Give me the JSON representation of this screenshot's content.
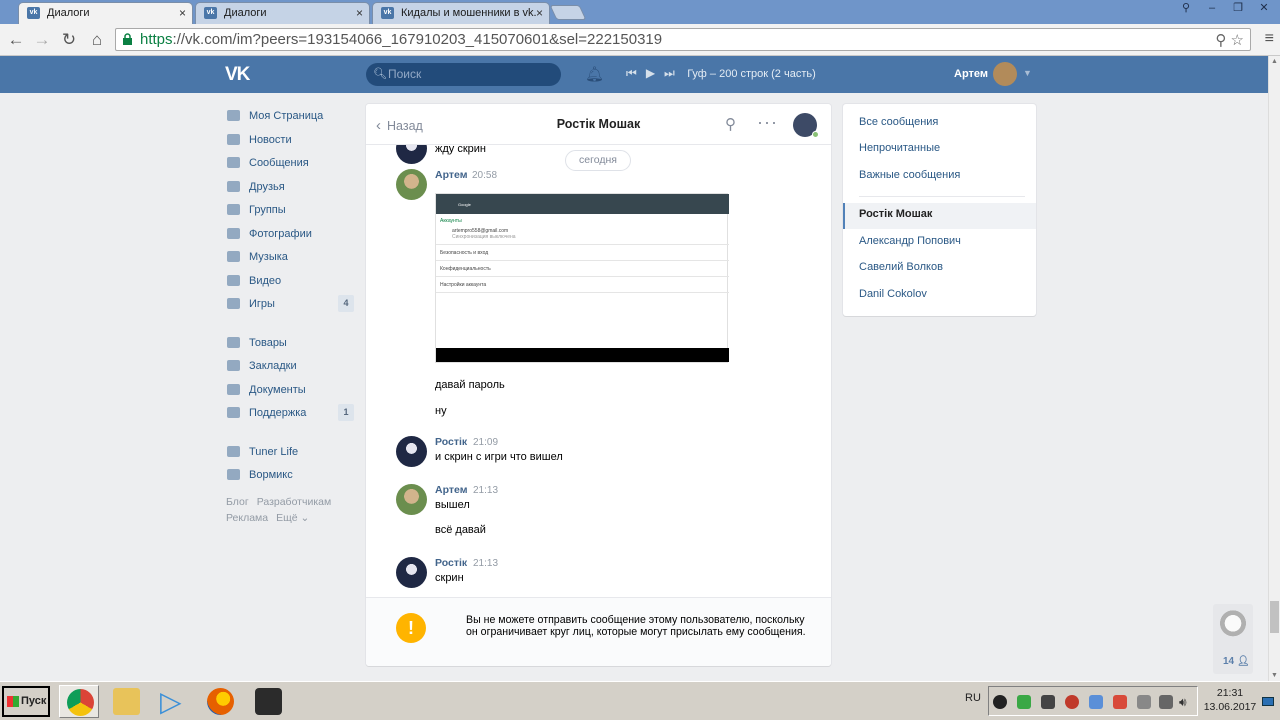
{
  "browser": {
    "tabs": [
      {
        "label": "Диалоги",
        "active": true
      },
      {
        "label": "Диалоги",
        "active": false
      },
      {
        "label": "Кидалы и мошенники в vk.",
        "active": false
      }
    ],
    "url_scheme": "https",
    "url_rest": "://vk.com/im?peers=193154066_167910203_415070601&sel=222150319",
    "window_buttons": [
      "⚲",
      "–",
      "❐",
      "✕"
    ]
  },
  "header": {
    "logo": "VK",
    "search_placeholder": "Поиск",
    "player_track": "Гуф – 200 строк (2 часть)",
    "user_name": "Артем"
  },
  "leftmenu": {
    "items": [
      {
        "label": "Моя Страница",
        "icon": "home-icon"
      },
      {
        "label": "Новости",
        "icon": "news-icon"
      },
      {
        "label": "Сообщения",
        "icon": "messages-icon"
      },
      {
        "label": "Друзья",
        "icon": "friends-icon"
      },
      {
        "label": "Группы",
        "icon": "groups-icon"
      },
      {
        "label": "Фотографии",
        "icon": "camera-icon"
      },
      {
        "label": "Музыка",
        "icon": "music-icon"
      },
      {
        "label": "Видео",
        "icon": "video-icon"
      },
      {
        "label": "Игры",
        "icon": "games-icon",
        "badge": "4"
      }
    ],
    "items2": [
      {
        "label": "Товары",
        "icon": "bag-icon"
      },
      {
        "label": "Закладки",
        "icon": "star-icon"
      },
      {
        "label": "Документы",
        "icon": "document-icon"
      },
      {
        "label": "Поддержка",
        "icon": "support-icon",
        "badge": "1"
      }
    ],
    "items3": [
      {
        "label": "Tuner Life",
        "icon": "app-icon"
      },
      {
        "label": "Вормикс",
        "icon": "rocket-icon"
      }
    ],
    "footer": [
      "Блог",
      "Разработчикам",
      "Реклама",
      "Ещё ⌄"
    ]
  },
  "chat": {
    "back_label": "Назад",
    "title": "Ростік Мошак",
    "date_divider": "сегодня",
    "partial_text": "жду скрин",
    "messages": [
      {
        "author": "Артем",
        "time": "20:58",
        "texts": [
          "давай пароль",
          "ну"
        ]
      },
      {
        "author": "Ростік",
        "time": "21:09",
        "texts": [
          "и скрин с игри что вишел"
        ]
      },
      {
        "author": "Артем",
        "time": "21:13",
        "texts": [
          "вышел",
          "всё давай"
        ]
      },
      {
        "author": "Ростік",
        "time": "21:13",
        "texts": [
          "скрин"
        ]
      }
    ],
    "attachment": {
      "app_title": "Google",
      "section": "Аккаунты",
      "email": "artempro558@gmail.com",
      "email_sub": "Синхронизация выключена",
      "rows": [
        "Безопасность и вход",
        "Конфиденциальность",
        "Настройки аккаунта"
      ]
    },
    "warning": "Вы не можете отправить сообщение этому пользователю, поскольку он ограничивает круг лиц, которые могут присылать ему сообщения."
  },
  "rightmenu": {
    "filters": [
      "Все сообщения",
      "Непрочитанные",
      "Важные сообщения"
    ],
    "dialogs": [
      "Ростік Мошак",
      "Александр Попович",
      "Савелий Волков",
      "Danil Cokolov"
    ]
  },
  "friends_widget": {
    "count": "14"
  },
  "taskbar": {
    "start_label": "Пуск",
    "lang": "RU",
    "time": "21:31",
    "date": "13.06.2017"
  },
  "colors": {
    "vk_blue": "#4a76a8",
    "link": "#2a5885",
    "warning": "#ffb400"
  }
}
